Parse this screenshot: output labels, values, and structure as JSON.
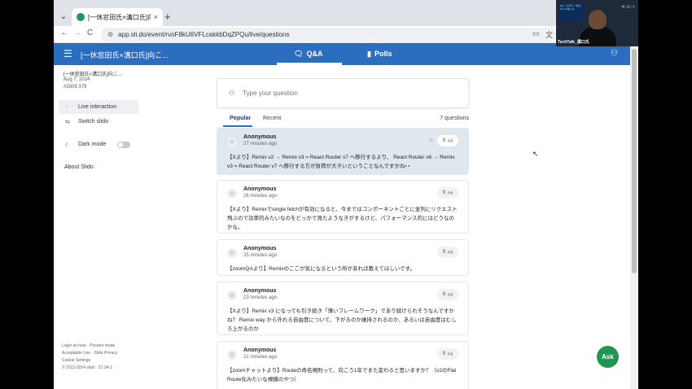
{
  "browser": {
    "tab_title": "[一休窓田氏×溝口氏]向こう一年",
    "tab_close": "×",
    "new_tab": "+",
    "dropdown": "⌄",
    "back": "←",
    "forward": "→",
    "reload": "C",
    "url": "app.sli.do/event/rvoF8kU6VFLcakkbDqZPQu/live/questions"
  },
  "header": {
    "event_title": "[一休窓田氏×溝口氏]向こ...",
    "tab_qa": "Q&A",
    "tab_polls": "Polls"
  },
  "sidebar": {
    "event_name": "[一休窓田氏×溝口氏]向こ...",
    "date": "Aug 7, 2024",
    "code": "#3309 379",
    "items": [
      {
        "label": "Live interaction",
        "icon": "chat-icon"
      },
      {
        "label": "Switch slido",
        "icon": "switch-icon"
      },
      {
        "label": "Dark mode",
        "icon": "moon-icon"
      }
    ],
    "about": "About Slido",
    "footer": [
      "Login as host · Present mode",
      "Acceptable Use · Slido Privacy",
      "Cookie Settings",
      "© 2012-2024 slido · 57.94.2"
    ]
  },
  "ask": {
    "placeholder": "Type your question",
    "fab_label": "Ask"
  },
  "list": {
    "tab_popular": "Popular",
    "tab_recent": "Recent",
    "count": "7 questions"
  },
  "questions": [
    {
      "author": "Anonymous",
      "time": "27 minutes ago",
      "likes": "0",
      "text": "【Xより】Remix v2 → Remix v3 = React Router v7 へ移行するより、 React Router v6 → Remix v3 = React Router v7 へ移行する方が負荷が大きいということなんですかね👀"
    },
    {
      "author": "Anonymous",
      "time": "26 minutes ago",
      "likes": "0",
      "text": "【Xより】Remixでsingle fetchが有効になると、今まではコンポーネントごとに並列にリクエスト飛ぶので効率的みたいなのをどっかで見たようなきがするけど、パフォーマンス的にはどうなのかな。"
    },
    {
      "author": "Anonymous",
      "time": "25 minutes ago",
      "likes": "0",
      "text": "【zoomQAより】Remixのここが気になるという所があれば教えてほしいです。"
    },
    {
      "author": "Anonymous",
      "time": "23 minutes ago",
      "likes": "0",
      "text": "【Xより】Remix v3 になっても引き続き「薄いフレームワーク」であり続けられそうなんですかね？ Remix way から外れる自由度について、下がるのか維持されるのか、あるいは自由度はむしろ上がるのか"
    },
    {
      "author": "Anonymous",
      "time": "21 minutes ago",
      "likes": "0",
      "text": "【zoomチャットより】Routeの命名規則って、向こう1年でまた変わると思いますか？（v2のFlat Route化みたいな規模のやつ）"
    }
  ],
  "webcam": {
    "name_label": "TechTalk_溝口氏",
    "slide_text": "向こう1年で一休のRemix導入は",
    "corner_text": "溝口 浩二 氏"
  },
  "icons": {
    "menu": "hamburger-icon",
    "user": "user-icon",
    "like": "thumbs-up-icon",
    "star": "star-icon",
    "cursor": "mouse-cursor-icon"
  },
  "colors": {
    "brand_blue": "#2b6dbf",
    "ask_green": "#219653",
    "highlight": "#dfe8ee"
  }
}
